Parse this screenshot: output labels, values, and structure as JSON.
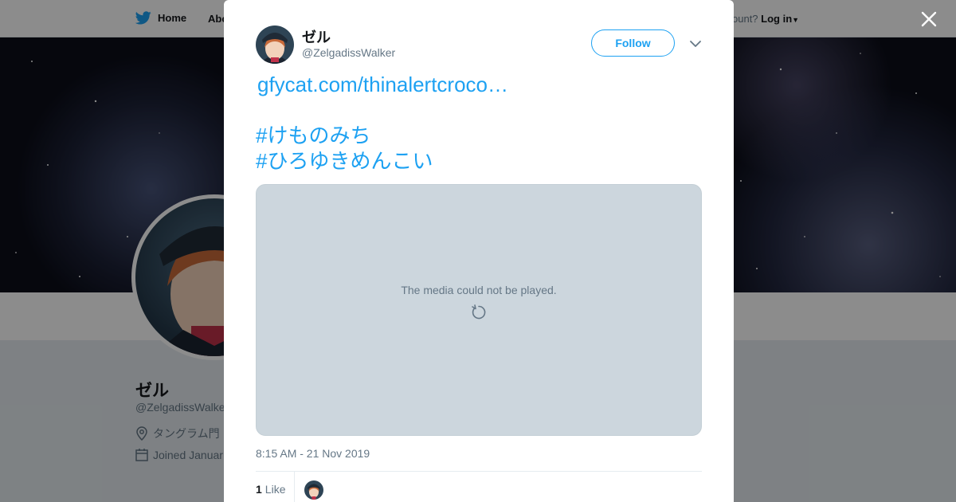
{
  "background": {
    "nav": {
      "home_label": "Home",
      "about_label": "Abo",
      "account_prompt": "ccount?",
      "login_label": "Log in"
    },
    "profile": {
      "name": "ゼル",
      "handle": "@ZelgadissWalke",
      "location": "タングラム門",
      "joined": "Joined Januar"
    }
  },
  "modal": {
    "author": {
      "name": "ゼル",
      "handle": "@ZelgadissWalker"
    },
    "follow_label": "Follow",
    "tweet": {
      "link": "gfycat.com/thinalertcroco…",
      "hashtags": [
        "#けものみち",
        "#ひろゆきめんこい"
      ]
    },
    "media": {
      "error_text": "The media could not be played."
    },
    "timestamp": "8:15 AM - 21 Nov 2019",
    "likes": {
      "count": "1",
      "label": "Like"
    }
  },
  "colors": {
    "accent": "#1da1f2",
    "muted_text": "#657786",
    "media_bg": "#ccd6dd"
  },
  "icons": [
    "twitter-bird-icon",
    "location-pin-icon",
    "calendar-icon",
    "close-icon",
    "chevron-down-icon",
    "retry-icon"
  ]
}
